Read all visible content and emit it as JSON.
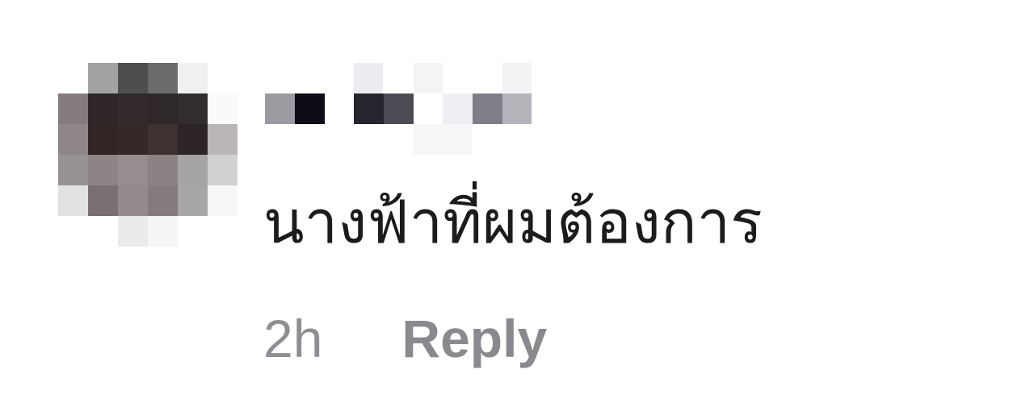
{
  "comment": {
    "author": {
      "avatar_state": "pixelated",
      "name_state": "pixelated"
    },
    "text": "นางฟ้าที่ผมต้องการ",
    "timestamp": "2h",
    "reply_label": "Reply"
  },
  "colors": {
    "text": "#1c1c1e",
    "meta": "#8e8e93",
    "background": "#ffffff"
  }
}
